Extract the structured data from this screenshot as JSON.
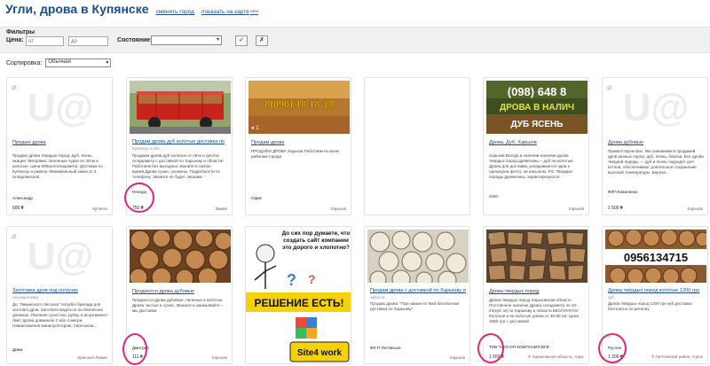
{
  "header": {
    "title": "Угли, дрова в Купянске",
    "change_city": "сменить город",
    "show_map": "показать на карте",
    "new_badge": "NEW"
  },
  "filters": {
    "title": "Фильтры",
    "price_label": "Цена:",
    "price_from_placeholder": "от",
    "price_to_placeholder": "до",
    "state_label": "Состояние:",
    "state_value": "",
    "ok": "✓",
    "reset": "✗"
  },
  "sort": {
    "label": "Сортировка:",
    "value": "Обычная"
  },
  "placeholder_text": "U@",
  "cards": [
    {
      "title": "Продаю дрова",
      "subtitle": "",
      "desc": "Продаю дрова твердых пород: Дуб, ясень, акация. Метровки, пиленные чурки по 30см и колотые. Цена 800грн/складометр. Доставка по Купянску и району. Минимальный заказ от 3 складометров",
      "seller": "Александр",
      "price": "600 ₴",
      "location": "Купянск"
    },
    {
      "title": "Продам дрова дуб колотые доставка по",
      "subtitle": "Купянску и обл",
      "desc": "Продаем дрова дуб колотые от пяти и десяти складометр с доставкой по Харькову и области! Работаем без выходных звоните в любое время.Дрова сухие, ухожены. Подробности по телефону. Звоните не будет лишним.",
      "seller": "Ненадо",
      "price": "750 ₴",
      "location": "Змиёв"
    },
    {
      "title": "Продам дрова",
      "subtitle": "",
      "desc": "ПРОДАЁМ ДРОВА Харьков Работаем по всем районам города",
      "seller": "Офис",
      "price": "",
      "location": "Харьков",
      "img_text": "8(096) 18 18 18"
    },
    {
      "title": "",
      "subtitle": "",
      "desc": "",
      "seller": "",
      "price": "",
      "location": ""
    },
    {
      "title": "Дрова, Дуб, Харьков",
      "subtitle": "",
      "desc": "Харьков Всегда в наличии наличии дрова твердых пород древесины – дуб на колотые. Дрова для доставки, укладываются одна к одному(на фото), не насыпом. Р.S. Твердые породы древесины, характеризуются.",
      "seller": "Олег",
      "price": "",
      "location": "Харьков",
      "img_text_top": "(098) 648 8",
      "img_text_mid": "ДРОВА В НАЛИЧ",
      "img_text_bot": "ДУБ ЯСЕНЬ"
    },
    {
      "title": "Дрова дубовые",
      "subtitle": "",
      "desc": "Приветствуем Вас. Мы занимаемся продажей дров разных пород: дуб, ясень, береза. Все дрова твердой породы — дуб и ясень подходят для котлов, обеспечивают длительное сохранение высокой температуры. Береза...",
      "seller": "ФЛП Коваленко",
      "price": "1 500 ₴",
      "location": "Харьков"
    },
    {
      "title": "Заготовка дров под погрузку",
      "subtitle": "лесозаготовка",
      "desc": "До \"Лиманского Лесхоза\" потрібні бригади для заготівлі дров. Заготівля ведеться на безпечних ділянках. Пиляння сухостою, рубку, в асортименті: Ліміт дрова довжиною 2 або 4 метри. Навантаження манипулятором. Своєчасна...",
      "seller": "Дима",
      "price": "",
      "location": "Красный Лиман"
    },
    {
      "title": "Продаются дрова дубовые",
      "subtitle": "",
      "desc": "Продаются дрова дубовые, пиленые и колотые. Дрова чистые и сухие. Звоните и заказывайте – мы Доставка",
      "seller": "Дмитрий",
      "price": "111 ₴",
      "location": "Харьков"
    },
    {
      "title": "",
      "subtitle": "",
      "desc": "",
      "seller": "",
      "price": "",
      "location": "",
      "ad_top": "До сих пор думаете, что создать сайт компании это дорого и хлопотно?",
      "ad_banner": "РЕШЕНИЕ ЕСТЬ!",
      "ad_brand": "Site4 work"
    },
    {
      "title": "Продам дрова с доставкой по Харькову и",
      "subtitle": "области",
      "desc": "Продаю дрова: \"При заказе от 5м3 бесплатная доставка по Харькову\"",
      "seller": "ФЛ-П Литовская",
      "price": "",
      "location": "Харьков"
    },
    {
      "title": "Дрова твердых пород",
      "subtitle": "",
      "desc": "Дрова твердых пород Харьковская область Постоянное наличие Дрова складометр по 10-24(куб. м) по Харькову и области БЕСПЛАТНО: Колотые и не колотые длина от 40-50 см. Цена 1650 грн с доставкой",
      "seller": "ТОВ \"НАЛ-ОП КОМПАНИЯ ВГБ\"",
      "price": "1 650 ₴",
      "location": "Харьковская область, Харь"
    },
    {
      "title": "Дрова твёрдых пород колотые 1200 грн",
      "subtitle": "куб",
      "desc": "Дрова твёрдых пород 1200 грн куб доставка бесплатно по региону",
      "seller": "Руслан",
      "price": "1 200 ₴",
      "location": "Полтавский район, Горох",
      "img_text": "0956134715"
    }
  ],
  "colors": {
    "link": "#1a4d8f",
    "annotation": "#e0247a",
    "filter_bg": "#eef0f2"
  }
}
